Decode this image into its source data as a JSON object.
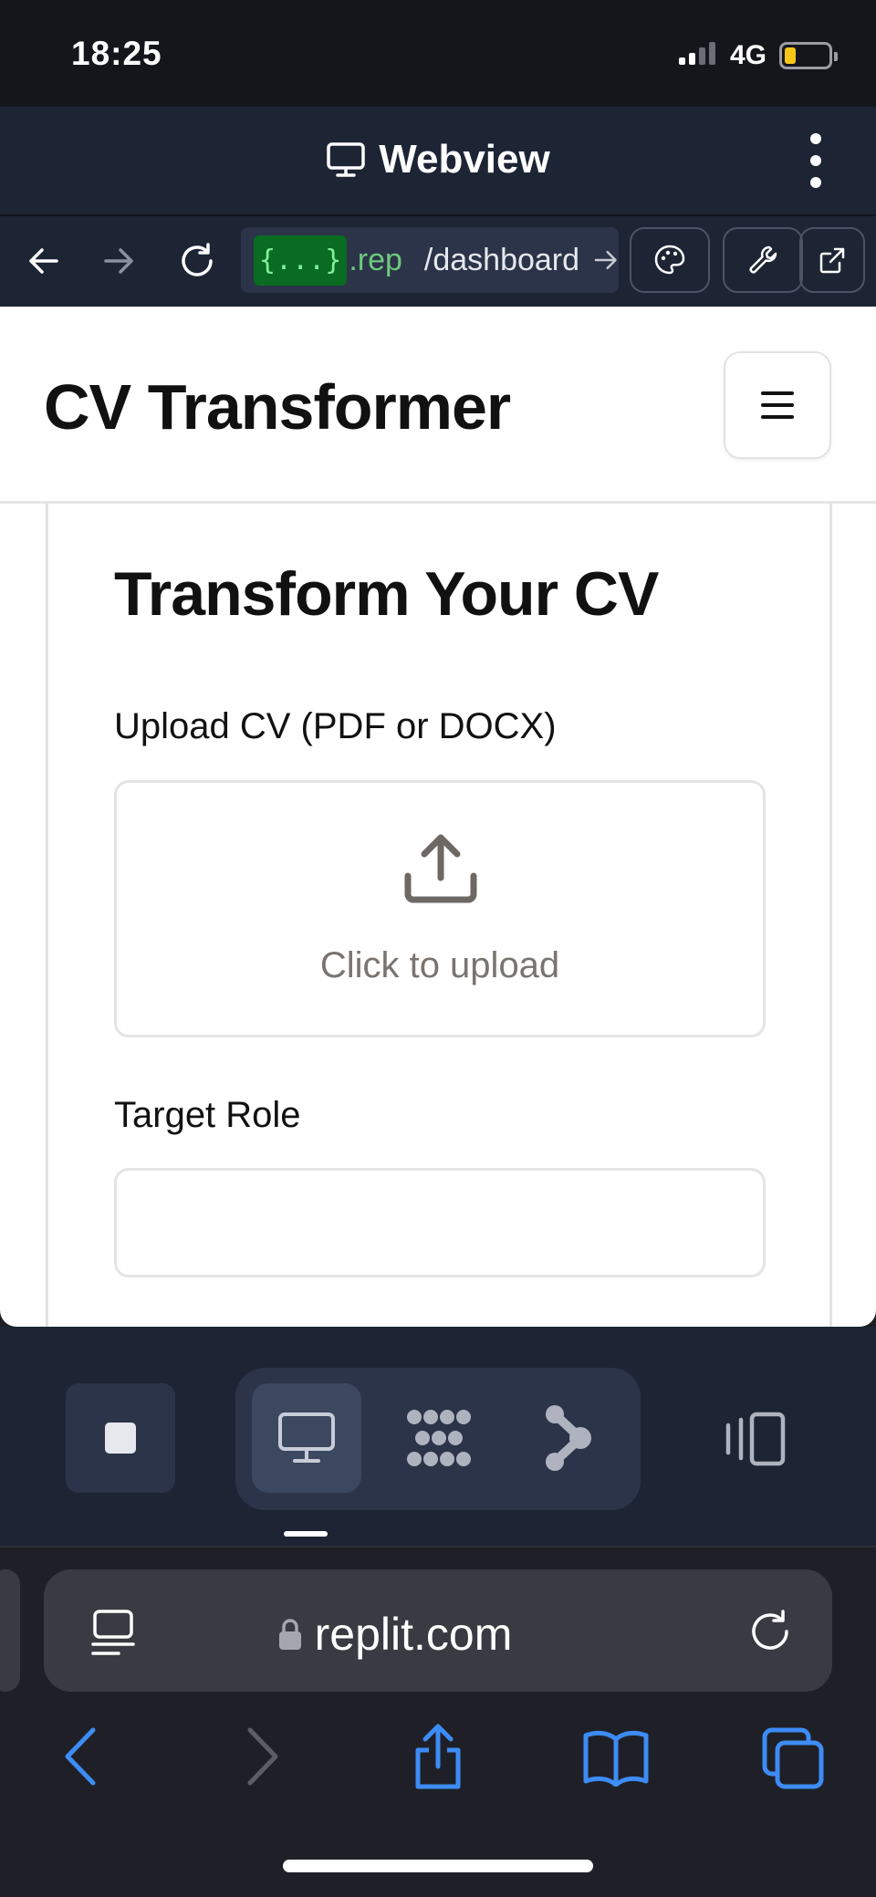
{
  "status_bar": {
    "time": "18:25",
    "network": "4G"
  },
  "replit_header": {
    "title": "Webview"
  },
  "replit_toolbar": {
    "url_badge": "{...}",
    "url_host": ".rep",
    "url_path": "/dashboard"
  },
  "app": {
    "title": "CV Transformer",
    "card_title": "Transform Your CV",
    "upload_label": "Upload CV (PDF or DOCX)",
    "upload_prompt": "Click to upload",
    "target_role_label": "Target Role",
    "target_role_value": ""
  },
  "safari": {
    "domain": "replit.com"
  },
  "colors": {
    "accent_blue": "#3d8cf5",
    "url_badge_bg": "#0a6b22",
    "replit_bg": "#1d2434"
  }
}
